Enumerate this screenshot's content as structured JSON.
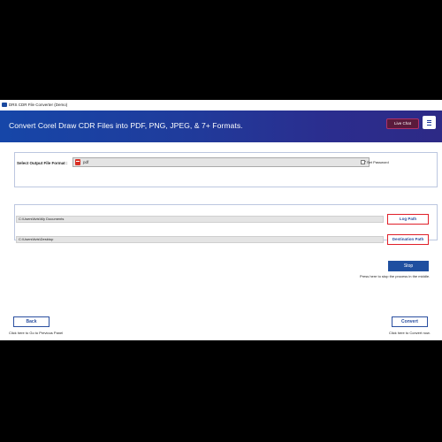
{
  "window": {
    "title": "DRS CDR File Converter (Demo)"
  },
  "header": {
    "title": "Convert Corel Draw CDR Files into PDF, PNG, JPEG, & 7+ Formats.",
    "live_chat": "Live Chat",
    "accent_color": "#1f3c9c"
  },
  "format": {
    "label": "Select Output File Format :",
    "selected": "pdf",
    "icon": "pdf-file-icon",
    "set_password": "Set Password"
  },
  "paths": {
    "log_path_value": "C:\\Users\\ltvis\\My Documents",
    "log_button": "Log Path",
    "destination_value": "C:\\Users\\ltvis\\Desktop",
    "destination_button": "Destination Path"
  },
  "stop": {
    "label": "Stop",
    "hint": "Press here to stop the process in the middle."
  },
  "footer": {
    "back_label": "Back",
    "back_hint": "Click here to Go to Previous Panel",
    "convert_label": "Convert",
    "convert_hint": "Click here to Convert now."
  }
}
